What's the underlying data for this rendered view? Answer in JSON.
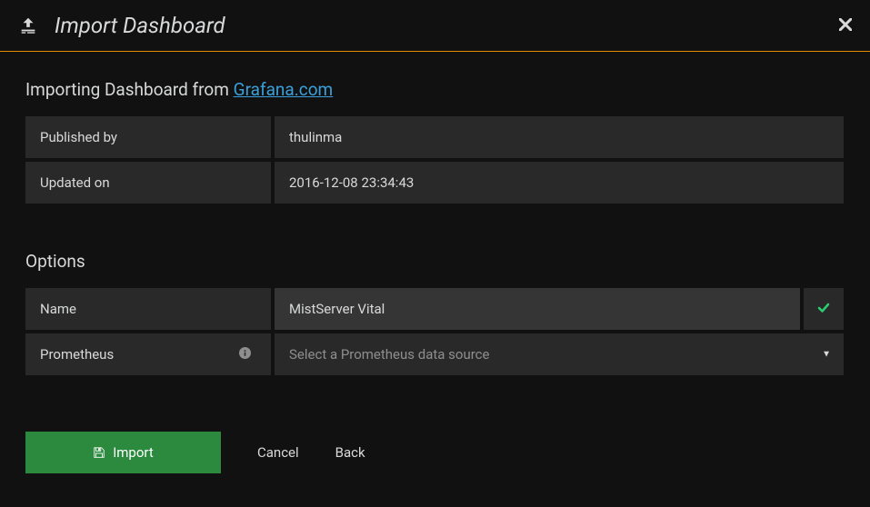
{
  "header": {
    "title": "Import Dashboard"
  },
  "section": {
    "heading_prefix": "Importing Dashboard from ",
    "heading_link": "Grafana.com"
  },
  "info": {
    "published_by_label": "Published by",
    "published_by_value": "thulinma",
    "updated_on_label": "Updated on",
    "updated_on_value": "2016-12-08 23:34:43"
  },
  "options": {
    "title": "Options",
    "name_label": "Name",
    "name_value": "MistServer Vital",
    "prometheus_label": "Prometheus",
    "prometheus_placeholder": "Select a Prometheus data source"
  },
  "actions": {
    "import_label": "Import",
    "cancel_label": "Cancel",
    "back_label": "Back"
  }
}
